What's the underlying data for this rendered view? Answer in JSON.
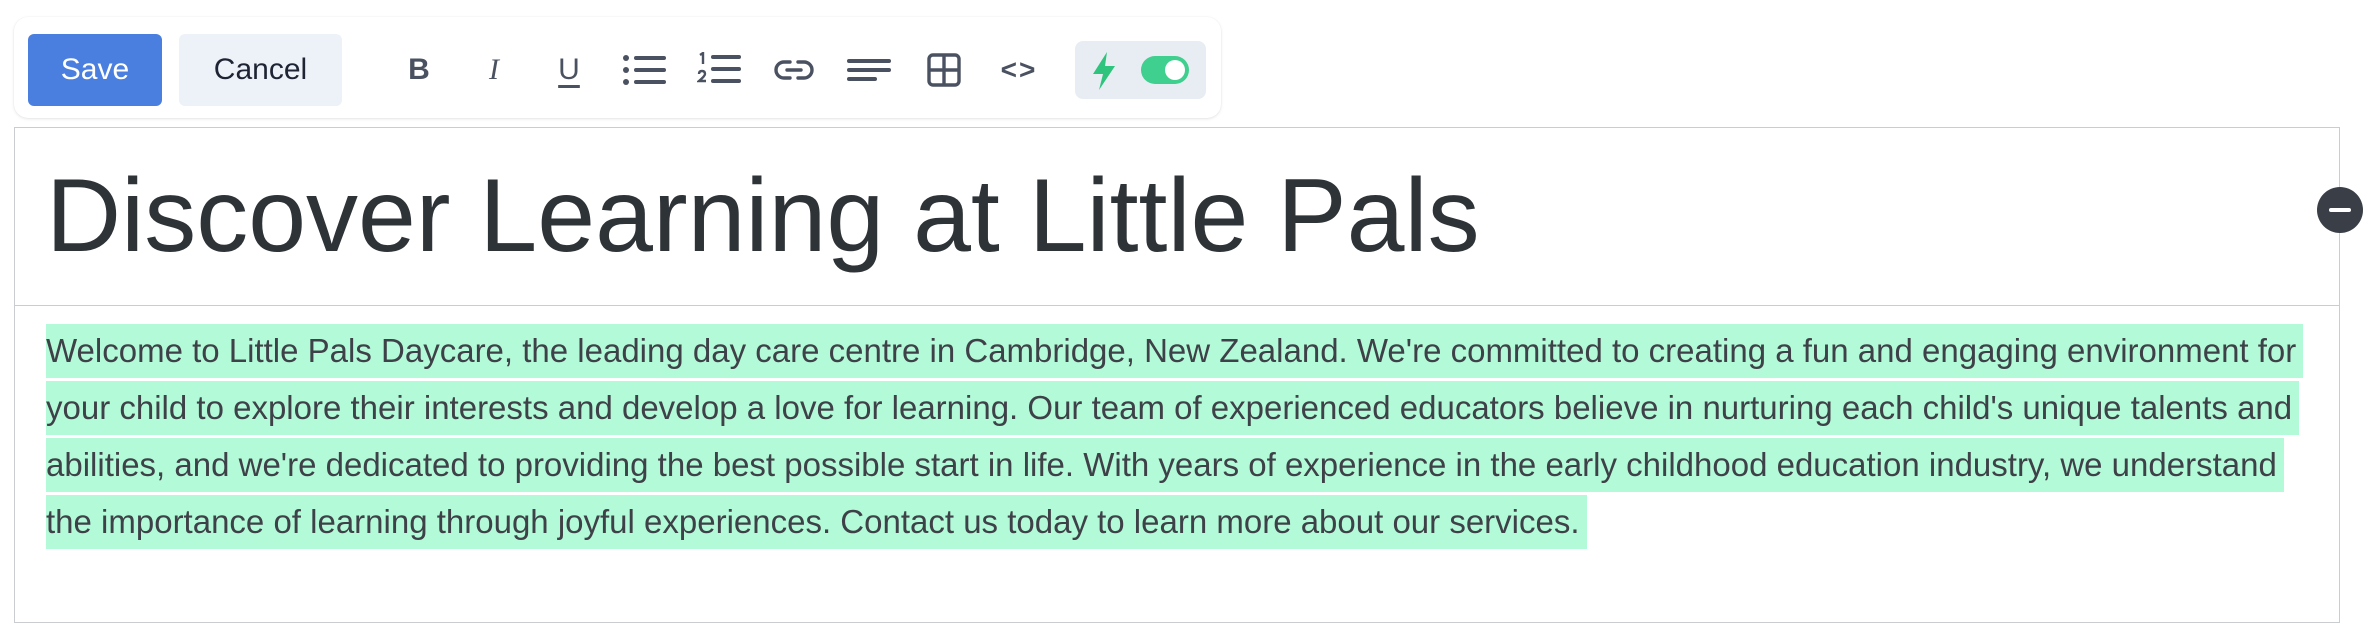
{
  "toolbar": {
    "save_label": "Save",
    "cancel_label": "Cancel",
    "tools": {
      "bold": "B",
      "italic": "I",
      "underline": "U",
      "code": "<>"
    },
    "icons": [
      "bold-icon",
      "italic-icon",
      "underline-icon",
      "bullet-list-icon",
      "numbered-list-icon",
      "link-icon",
      "align-icon",
      "table-icon",
      "code-icon",
      "lightning-icon",
      "toggle-switch"
    ],
    "ai_toggle_on": true
  },
  "content": {
    "heading": "Discover Learning at Little Pals",
    "paragraph": "Welcome to Little Pals Daycare, the leading day care centre in Cambridge, New Zealand. We're committed to creating a fun and engaging environment for your child to explore their interests and develop a love for learning. Our team of experienced educators believe in nurturing each child's unique talents and abilities, and we're dedicated to providing the best possible start in life. With years of experience in the early childhood education industry, we understand the importance of learning through joyful experiences. Contact us today to learn more about our services."
  },
  "colors": {
    "save_button": "#4a7fe0",
    "cancel_button": "#edf1f8",
    "highlight": "#b3fad8",
    "toggle_on": "#3fcf8e",
    "lightning": "#2fc47e",
    "remove_button": "#3a3f47"
  }
}
